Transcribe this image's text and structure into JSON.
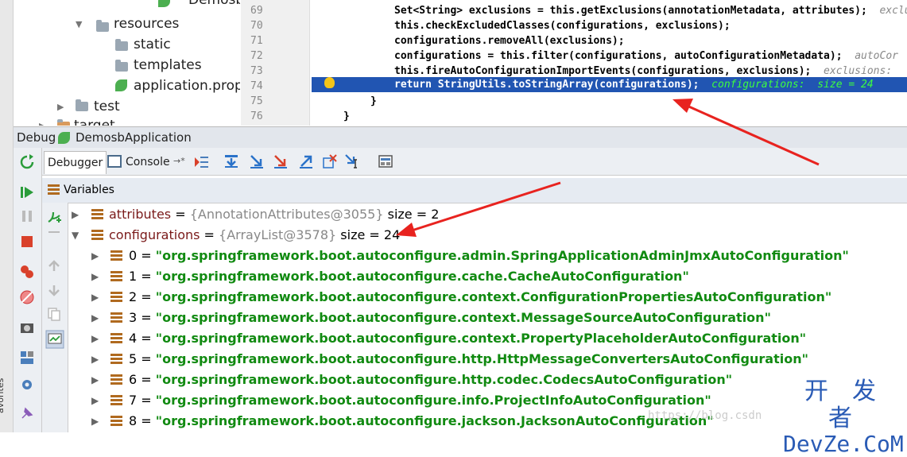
{
  "favorites_label": "avorites",
  "project_tree": {
    "items": [
      {
        "label": "Demosb",
        "type": "leaf"
      },
      {
        "label": "resources",
        "type": "folder"
      },
      {
        "label": "static",
        "type": "folder"
      },
      {
        "label": "templates",
        "type": "folder"
      },
      {
        "label": "application.prope",
        "type": "leaf"
      },
      {
        "label": "test",
        "type": "folder"
      },
      {
        "label": "target",
        "type": "folder"
      }
    ]
  },
  "editor": {
    "line_numbers": [
      "69",
      "70",
      "71",
      "72",
      "73",
      "74",
      "75",
      "76"
    ],
    "lines": [
      {
        "code": "Set<String> exclusions = this.getExclusions(annotationMetadata, attributes);",
        "hint": "exclu"
      },
      {
        "code": "this.checkExcludedClasses(configurations, exclusions);",
        "hint": ""
      },
      {
        "code": "configurations.removeAll(exclusions);",
        "hint": ""
      },
      {
        "code": "configurations = this.filter(configurations, autoConfigurationMetadata);",
        "hint": "autoCor"
      },
      {
        "code": "this.fireAutoConfigurationImportEvents(configurations, exclusions);",
        "hint": "exclusions:"
      },
      {
        "code": "return StringUtils.toStringArray(configurations);",
        "hint": "configurations:  size = 24"
      },
      {
        "code": "}",
        "hint": ""
      },
      {
        "code": "}",
        "hint": ""
      }
    ]
  },
  "debug": {
    "title": "Debug",
    "config_name": "DemosbApplication",
    "tabs": {
      "debugger": "Debugger",
      "console": "Console"
    },
    "variables_label": "Variables",
    "variables": [
      {
        "name": "attributes",
        "ref": "{AnnotationAttributes@3055}",
        "size": "size = 2"
      },
      {
        "name": "configurations",
        "ref": "{ArrayList@3578}",
        "size": "size = 24"
      }
    ],
    "items": [
      {
        "index": "0",
        "value": "\"org.springframework.boot.autoconfigure.admin.SpringApplicationAdminJmxAutoConfiguration\""
      },
      {
        "index": "1",
        "value": "\"org.springframework.boot.autoconfigure.cache.CacheAutoConfiguration\""
      },
      {
        "index": "2",
        "value": "\"org.springframework.boot.autoconfigure.context.ConfigurationPropertiesAutoConfiguration\""
      },
      {
        "index": "3",
        "value": "\"org.springframework.boot.autoconfigure.context.MessageSourceAutoConfiguration\""
      },
      {
        "index": "4",
        "value": "\"org.springframework.boot.autoconfigure.context.PropertyPlaceholderAutoConfiguration\""
      },
      {
        "index": "5",
        "value": "\"org.springframework.boot.autoconfigure.http.HttpMessageConvertersAutoConfiguration\""
      },
      {
        "index": "6",
        "value": "\"org.springframework.boot.autoconfigure.http.codec.CodecsAutoConfiguration\""
      },
      {
        "index": "7",
        "value": "\"org.springframework.boot.autoconfigure.info.ProjectInfoAutoConfiguration\""
      },
      {
        "index": "8",
        "value": "\"org.springframework.boot.autoconfigure.jackson.JacksonAutoConfiguration\""
      }
    ]
  },
  "watermark": {
    "top": "开 发 者",
    "bottom": "DevZe.CoM",
    "url": "https://blog.csdn"
  },
  "colors": {
    "exec_line": "#2155b2",
    "string_value": "#118a11",
    "arrow": "#e8231f"
  }
}
